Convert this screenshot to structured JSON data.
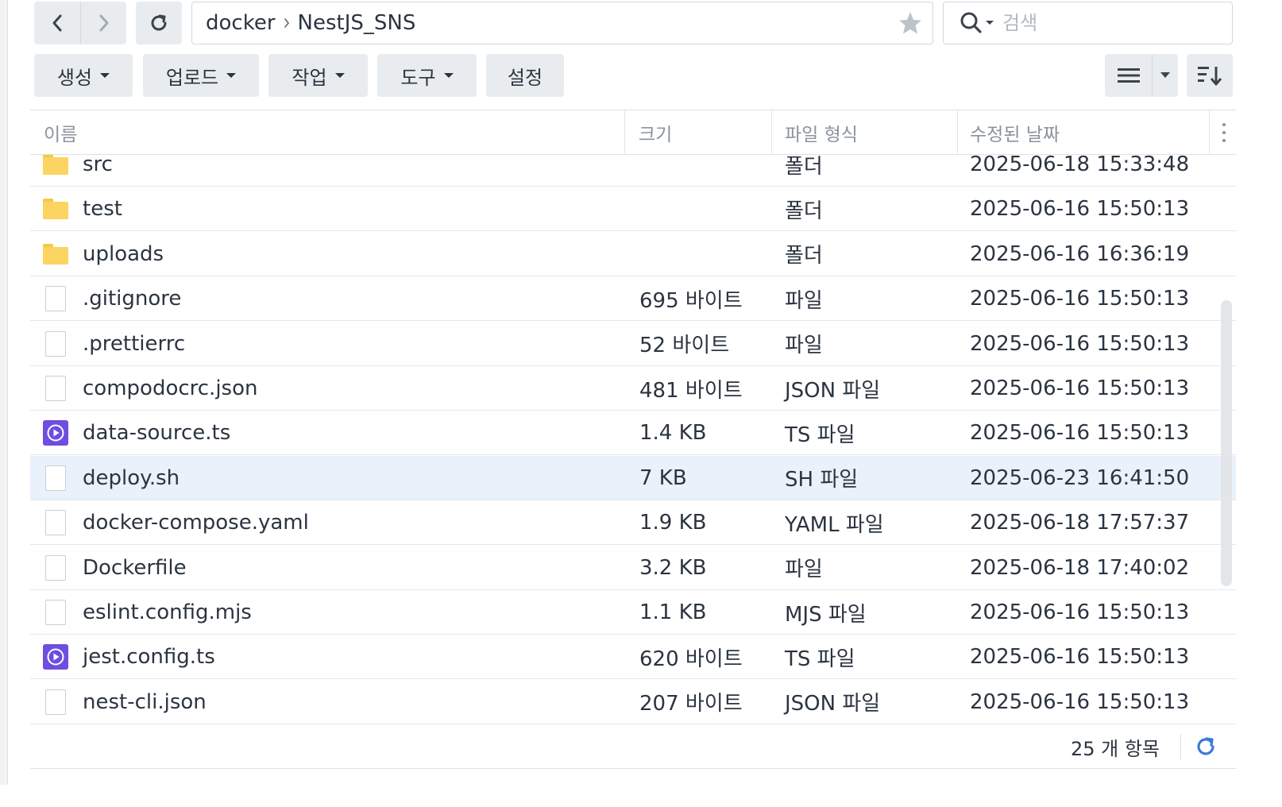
{
  "toolbar_top": {
    "breadcrumb": [
      "docker",
      "NestJS_SNS"
    ],
    "search_placeholder": "검색"
  },
  "toolbar": {
    "create_label": "생성",
    "upload_label": "업로드",
    "action_label": "작업",
    "tools_label": "도구",
    "settings_label": "설정"
  },
  "columns": {
    "name": "이름",
    "size": "크기",
    "type": "파일 형식",
    "modified": "수정된 날짜"
  },
  "files": [
    {
      "icon": "folder",
      "name": "src",
      "size": "",
      "type": "폴더",
      "modified": "2025-06-18 15:33:48"
    },
    {
      "icon": "folder",
      "name": "test",
      "size": "",
      "type": "폴더",
      "modified": "2025-06-16 15:50:13"
    },
    {
      "icon": "folder",
      "name": "uploads",
      "size": "",
      "type": "폴더",
      "modified": "2025-06-16 16:36:19"
    },
    {
      "icon": "file",
      "name": ".gitignore",
      "size": "695 바이트",
      "type": "파일",
      "modified": "2025-06-16 15:50:13"
    },
    {
      "icon": "file",
      "name": ".prettierrc",
      "size": "52 바이트",
      "type": "파일",
      "modified": "2025-06-16 15:50:13"
    },
    {
      "icon": "file",
      "name": "compodocrc.json",
      "size": "481 바이트",
      "type": "JSON 파일",
      "modified": "2025-06-16 15:50:13"
    },
    {
      "icon": "ts",
      "name": "data-source.ts",
      "size": "1.4 KB",
      "type": "TS 파일",
      "modified": "2025-06-16 15:50:13"
    },
    {
      "icon": "file",
      "name": "deploy.sh",
      "size": "7 KB",
      "type": "SH 파일",
      "modified": "2025-06-23 16:41:50",
      "selected": true
    },
    {
      "icon": "file",
      "name": "docker-compose.yaml",
      "size": "1.9 KB",
      "type": "YAML 파일",
      "modified": "2025-06-18 17:57:37"
    },
    {
      "icon": "file",
      "name": "Dockerfile",
      "size": "3.2 KB",
      "type": "파일",
      "modified": "2025-06-18 17:40:02"
    },
    {
      "icon": "file",
      "name": "eslint.config.mjs",
      "size": "1.1 KB",
      "type": "MJS 파일",
      "modified": "2025-06-16 15:50:13"
    },
    {
      "icon": "ts",
      "name": "jest.config.ts",
      "size": "620 바이트",
      "type": "TS 파일",
      "modified": "2025-06-16 15:50:13"
    },
    {
      "icon": "file",
      "name": "nest-cli.json",
      "size": "207 바이트",
      "type": "JSON 파일",
      "modified": "2025-06-16 15:50:13"
    }
  ],
  "footer": {
    "item_count": "25 개 항목"
  },
  "colors": {
    "accent": "#3a7bd5",
    "folder": "#fbd461",
    "ts_icon": "#6d4ee0",
    "selected_row": "#e9f1fb"
  }
}
